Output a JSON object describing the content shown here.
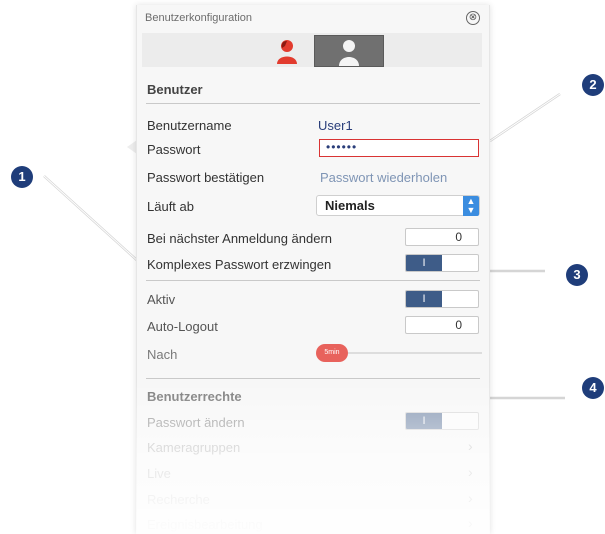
{
  "window": {
    "title": "Benutzerkonfiguration",
    "close_icon": "⊗"
  },
  "section_user": {
    "header": "Benutzer"
  },
  "fields": {
    "username_label": "Benutzername",
    "username_value": "User1",
    "password_label": "Passwort",
    "password_value": "••••••",
    "confirm_label": "Passwort bestätigen",
    "confirm_placeholder": "Passwort wiederholen",
    "expires_label": "Läuft ab",
    "expires_value": "Niemals",
    "change_next_login_label": "Bei nächster Anmeldung ändern",
    "change_next_login_toggle": "0",
    "complex_password_label": "Komplexes Passwort erzwingen",
    "complex_password_toggle": "I",
    "active_label": "Aktiv",
    "active_toggle": "I",
    "auto_logout_label": "Auto-Logout",
    "auto_logout_toggle": "0",
    "after_label": "Nach",
    "after_value": "5min"
  },
  "section_rights": {
    "header": "Benutzerrechte",
    "change_password_label": "Passwort ändern",
    "change_password_toggle": "I",
    "items": [
      "Kameragruppen",
      "Live",
      "Recherche",
      "Ereignisbearbeitung"
    ]
  },
  "callouts": [
    "1",
    "2",
    "3",
    "4"
  ],
  "colors": {
    "accent_blue": "#3e5c88",
    "callout": "#1f3d7a",
    "error_red": "#d93333",
    "slider_red": "#e8625c"
  }
}
